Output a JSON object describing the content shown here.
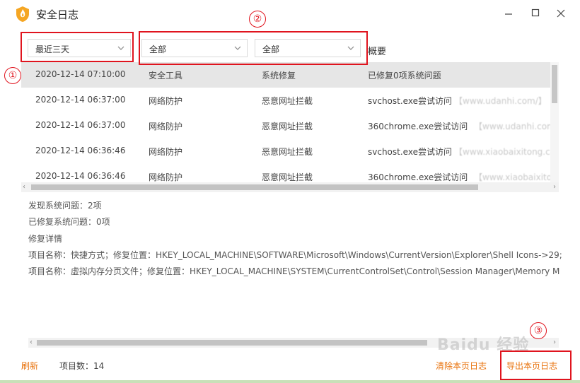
{
  "window": {
    "title": "安全日志"
  },
  "filters": {
    "time_range": "最近三天",
    "category": "全部",
    "type": "全部"
  },
  "table": {
    "summary_header": "概要",
    "rows": [
      {
        "time": "2020-12-14 07:10:00",
        "category": "安全工具",
        "type": "系统修复",
        "summary": "已修复0项系统问题",
        "extra": ""
      },
      {
        "time": "2020-12-14 06:37:00",
        "category": "网络防护",
        "type": "恶意网址拦截",
        "summary": "svchost.exe尝试访问",
        "extra": "【www.udanhi.com/】"
      },
      {
        "time": "2020-12-14 06:37:00",
        "category": "网络防护",
        "type": "恶意网址拦截",
        "summary": "360chrome.exe尝试访问",
        "extra": "【www.udanhi.com/fa"
      },
      {
        "time": "2020-12-14 06:36:46",
        "category": "网络防护",
        "type": "恶意网址拦截",
        "summary": "svchost.exe尝试访问",
        "extra": "【www.xiaobaixitong.com"
      },
      {
        "time": "2020-12-14 06:36:46",
        "category": "网络防护",
        "type": "恶意网址拦截",
        "summary": "360chrome.exe尝试访问",
        "extra": "【www.xiaobaixitong."
      }
    ]
  },
  "details": {
    "lines": [
      "发现系统问题：2项",
      "已修复系统问题：0项",
      "修复详情",
      "项目名称：快捷方式；修复位置：HKEY_LOCAL_MACHINE\\SOFTWARE\\Microsoft\\Windows\\CurrentVersion\\Explorer\\Shell Icons->29;",
      "项目名称：虚拟内存分页文件；修复位置：HKEY_LOCAL_MACHINE\\SYSTEM\\CurrentControlSet\\Control\\Session Manager\\Memory M"
    ]
  },
  "footer": {
    "refresh": "刷新",
    "count_label": "项目数：14",
    "clear": "清除本页日志",
    "export": "导出本页日志"
  },
  "annotations": [
    "①",
    "②",
    "③"
  ],
  "watermark": "Baidu 经验",
  "colors": {
    "accent": "#e8710a",
    "annotation": "#e0141e",
    "selected_row": "#e6e6e6"
  },
  "icons": [
    "shield-logo-icon",
    "minimize-icon",
    "maximize-icon",
    "close-icon",
    "chevron-down-icon"
  ]
}
